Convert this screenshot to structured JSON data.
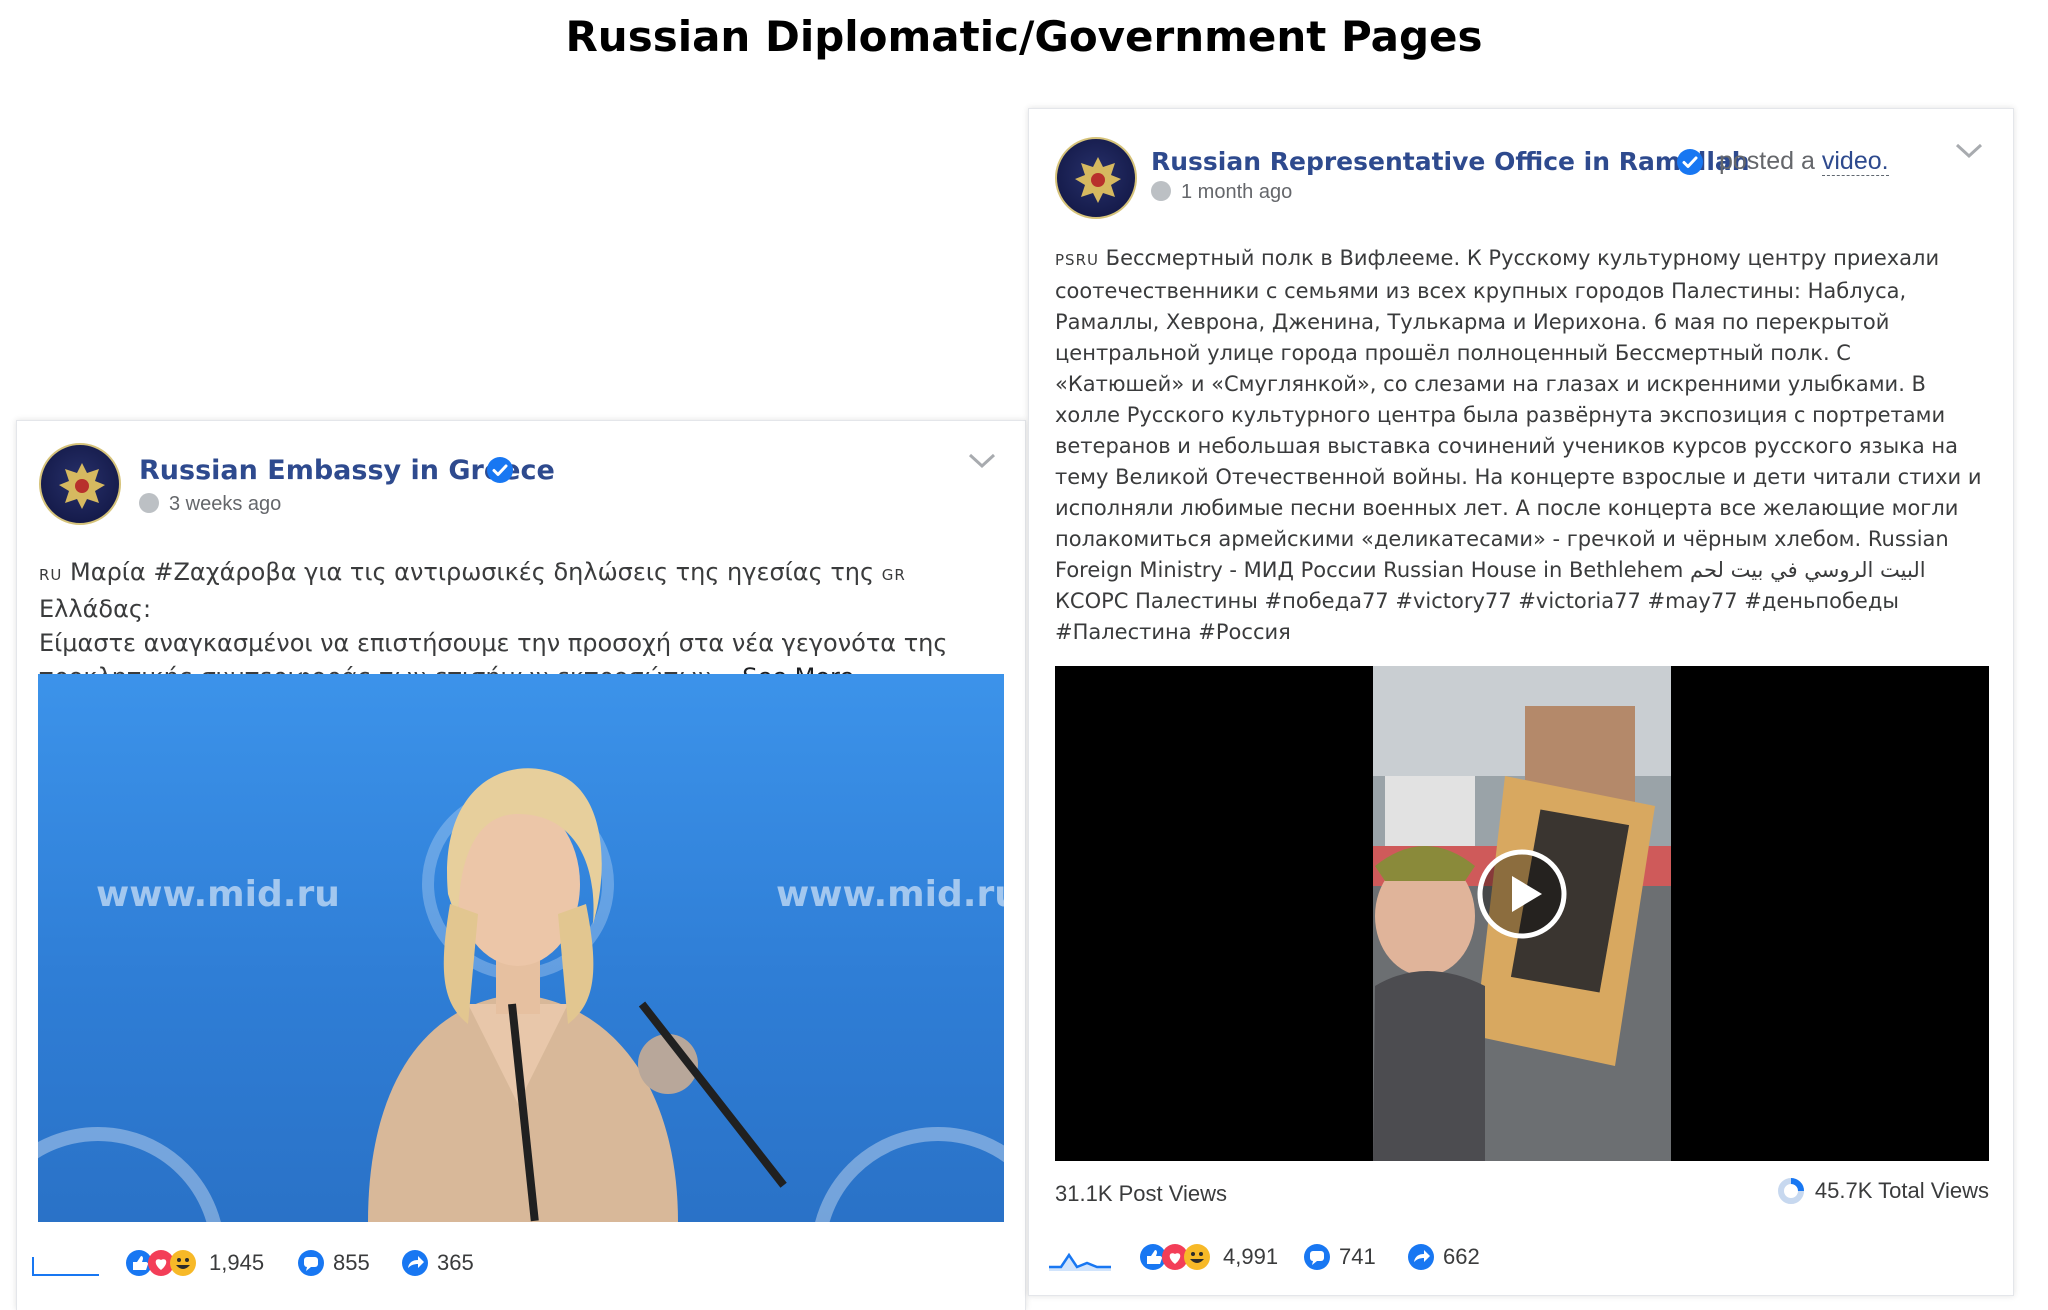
{
  "title": "Russian Diplomatic/Government Pages",
  "left_post": {
    "page_name": "Russian Embassy in Greece",
    "time": "3 weeks ago",
    "lang_tag_1": "RU",
    "line1_a": "Μαρία #Ζαχάροβα για τις αντιρωσικές δηλώσεις της ηγεσίας της",
    "lang_tag_2": "GR",
    "line1_b": "Ελλάδας:",
    "line2": "Είμαστε αναγκασμένοι να επιστήσουμε την προσοχή στα νέα γεγονότα της",
    "line3": "προκλητικής συμπεριφοράς των επισήμων εκπροσώπων...",
    "see_more": "See More",
    "watermark_left": "www.mid.ru",
    "watermark_right": "www.mid.ru",
    "reactions": "1,945",
    "comments": "855",
    "shares": "365"
  },
  "right_post": {
    "page_name": "Russian Representative Office in Ramallah",
    "posted_a": "posted a",
    "video_link": "video.",
    "time": "1 month ago",
    "lang_tag": "PSRU",
    "lines": [
      "Бессмертный полк в Вифлееме. К Русскому культурному центру приехали",
      "соотечественники с семьями из всех крупных городов Палестины: Наблуса,",
      "Рамаллы, Хеврона, Дженина, Тулькарма и Иерихона. 6 мая по перекрытой",
      "центральной улице города прошёл полноценный Бессмертный полк. С",
      "«Катюшей» и «Смуглянкой», со слезами на глазах и искренними улыбками. В",
      "холле Русского культурного центра была развёрнута экспозиция с портретами",
      "ветеранов и небольшая выставка сочинений учеников курсов русского языка на",
      "тему Великой Отечественной войны. На концерте взрослые и дети читали стихи и",
      "исполняли любимые песни военных лет. А после концерта все желающие могли",
      "полакомиться армейскими «деликатесами» - гречкой и чёрным хлебом. Russian",
      "Foreign Ministry - МИД России Russian House in Bethlehem البيت الروسي في بيت لحم",
      "КСОРС Палестины #победа77 #victory77 #victoria77 #may77 #деньпобеды",
      "#Палестина #Россия"
    ],
    "post_views": "31.1K Post Views",
    "total_views": "45.7K Total Views",
    "reactions": "4,991",
    "comments": "741",
    "shares": "662"
  },
  "colors": {
    "page_name": "#2e4a8e",
    "verified": "#1877f2",
    "link": "#1877f2"
  }
}
